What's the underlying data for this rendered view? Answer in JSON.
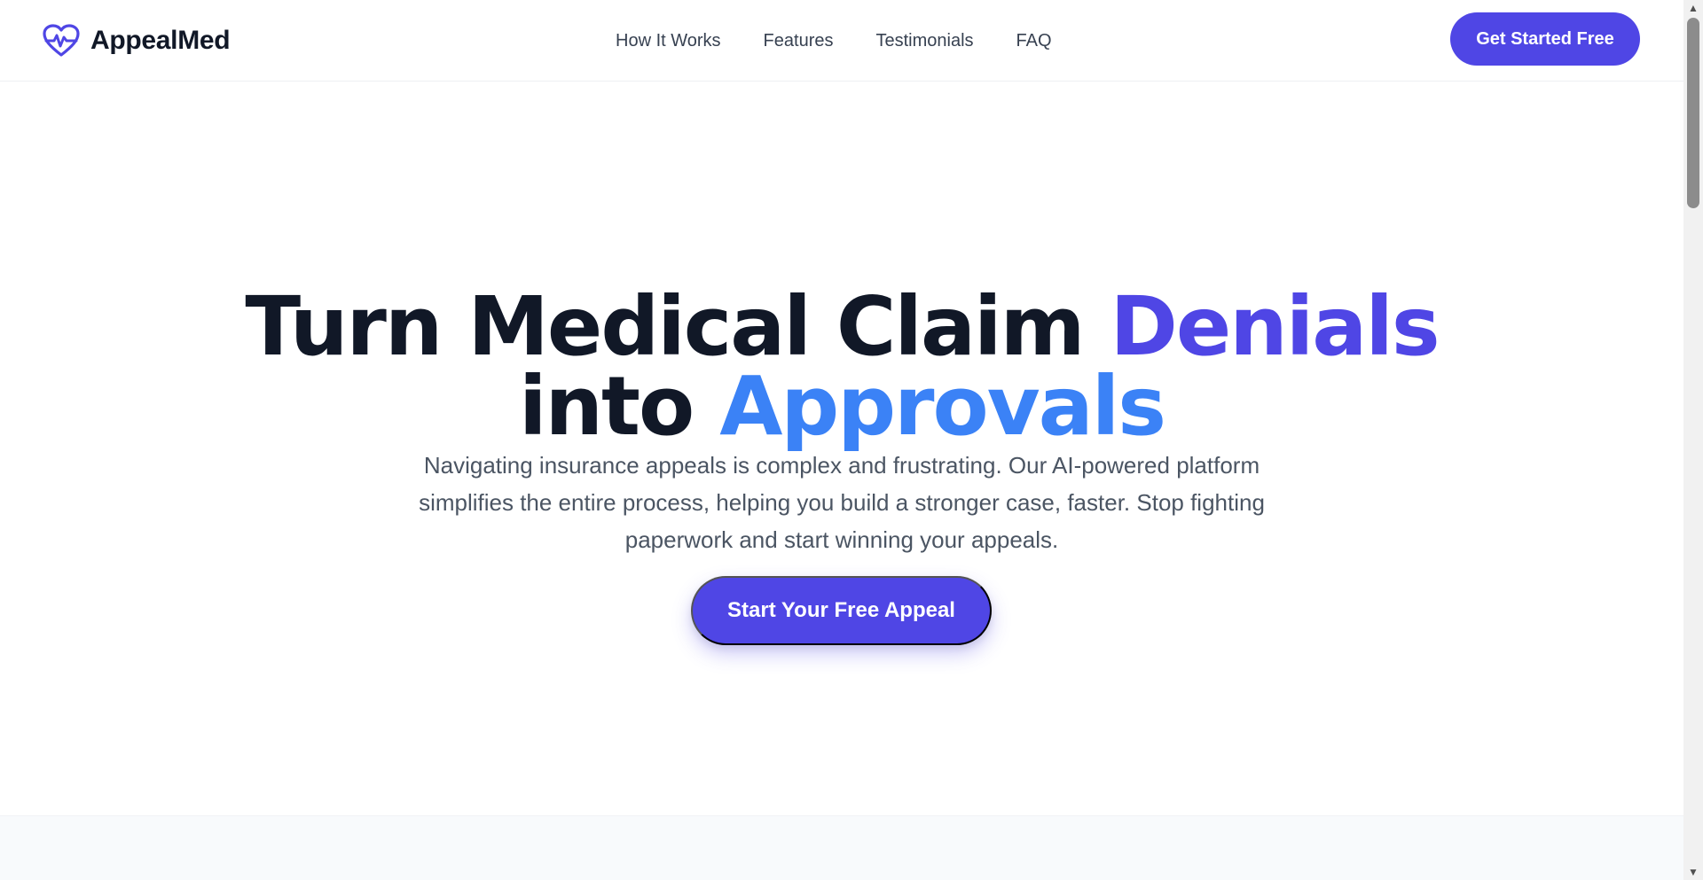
{
  "header": {
    "brand_name": "AppealMed",
    "brand_icon": "heart-pulse-icon",
    "nav": [
      {
        "label": "How It Works"
      },
      {
        "label": "Features"
      },
      {
        "label": "Testimonials"
      },
      {
        "label": "FAQ"
      }
    ],
    "cta_label": "Get Started Free"
  },
  "hero": {
    "title_part1": "Turn Medical Claim ",
    "title_highlight1": "Denials",
    "title_part2": "into ",
    "title_highlight2": "Approvals",
    "subtitle": "Navigating insurance appeals is complex and frustrating. Our AI-powered platform simplifies the entire process, helping you build a stronger case, faster. Stop fighting paperwork and start winning your appeals.",
    "cta_label": "Start Your Free Appeal"
  },
  "colors": {
    "accent": "#4f46e5",
    "accent_blue": "#3b82f6",
    "text_dark": "#111827",
    "text_muted": "#4b5563"
  }
}
